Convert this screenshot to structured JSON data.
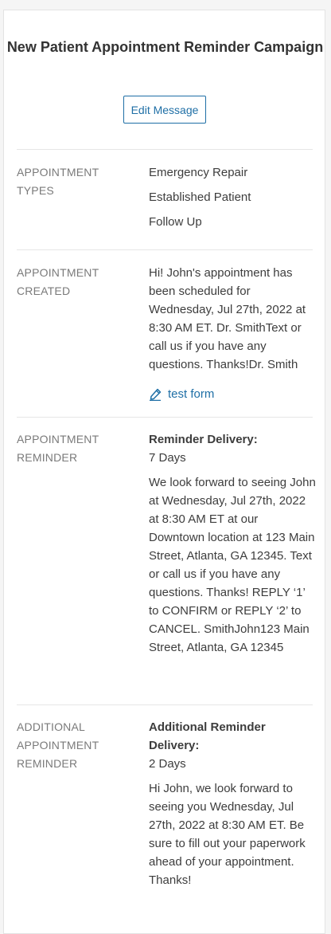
{
  "title": "New Patient Appointment Reminder Campaign",
  "edit_button": "Edit Message",
  "sections": {
    "types": {
      "label": "APPOINTMENT TYPES",
      "items": [
        "Emergency Repair",
        "Established Patient",
        "Follow Up"
      ]
    },
    "created": {
      "label": "APPOINTMENT CREATED",
      "message": "Hi! John's appointment has been scheduled for Wednesday, Jul 27th, 2022 at 8:30 AM ET. Dr. SmithText or call us if you have any questions. Thanks!Dr. Smith",
      "link_text": "test form",
      "link_icon": "form-edit-icon"
    },
    "reminder": {
      "label": "APPOINTMENT REMINDER",
      "delivery_heading": "Reminder Delivery:",
      "delivery_value": "7 Days",
      "message": "We look forward to seeing John at Wednesday, Jul 27th, 2022 at 8:30 AM ET at our Downtown location at 123 Main Street, Atlanta, GA 12345. Text or call us if you have any questions. Thanks! REPLY ‘1’ to CONFIRM or REPLY ‘2’ to CANCEL. SmithJohn123 Main Street, Atlanta, GA 12345"
    },
    "additional": {
      "label": "ADDITIONAL APPOINTMENT REMINDER",
      "delivery_heading": "Additional Reminder Delivery:",
      "delivery_value": "2 Days",
      "message": "Hi John, we look forward to seeing you Wednesday, Jul 27th, 2022 at 8:30 AM ET. Be sure to fill out your paperwork ahead of your appointment. Thanks!"
    }
  },
  "colors": {
    "accent": "#1f6fa6",
    "label": "#7a7a7a",
    "text": "#3d3d3d",
    "divider": "#e6e6e6"
  }
}
